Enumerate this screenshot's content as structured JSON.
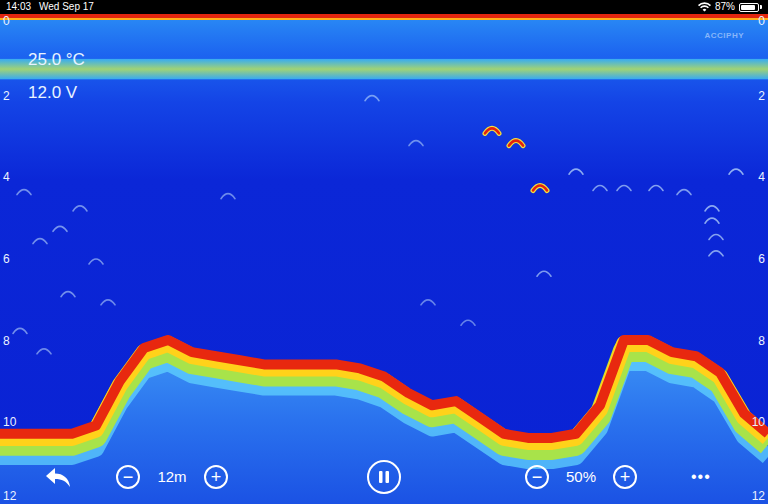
{
  "status_bar": {
    "time": "14:03",
    "date": "Wed Sep 17",
    "wifi": true,
    "battery": {
      "text": "87%",
      "level": 0.87
    }
  },
  "watermark": "ACCIPHY",
  "readings": [
    "25.0 °C",
    "12.0 V"
  ],
  "depth_scale": {
    "ticks": [
      "0",
      "2",
      "4",
      "6",
      "8",
      "10",
      "12"
    ],
    "max_depth": 12
  },
  "sonar": {
    "pings": 192,
    "surface_band": [
      1.1,
      1.6
    ],
    "bottom_depths": [
      9.9,
      9.9,
      9.9,
      9.9,
      9.7,
      8.6,
      7.8,
      7.6,
      7.9,
      8.0,
      8.1,
      8.2,
      8.2,
      8.2,
      8.2,
      8.3,
      8.5,
      8.9,
      9.2,
      9.1,
      9.5,
      9.9,
      10.0,
      10.0,
      9.9,
      9.2,
      7.6,
      7.6,
      7.9,
      8.0,
      8.4,
      9.4,
      9.9
    ],
    "fish": [
      {
        "ping": 123,
        "depth": 2.8,
        "strength": 0.95
      },
      {
        "ping": 129,
        "depth": 3.1,
        "strength": 0.9
      },
      {
        "ping": 135,
        "depth": 4.2,
        "strength": 0.9
      },
      {
        "ping": 144,
        "depth": 3.8,
        "strength": 0.5
      },
      {
        "ping": 150,
        "depth": 4.2,
        "strength": 0.4
      },
      {
        "ping": 156,
        "depth": 4.2,
        "strength": 0.4
      },
      {
        "ping": 164,
        "depth": 4.2,
        "strength": 0.45
      },
      {
        "ping": 171,
        "depth": 4.3,
        "strength": 0.4
      },
      {
        "ping": 184,
        "depth": 3.8,
        "strength": 0.55
      },
      {
        "ping": 178,
        "depth": 4.7,
        "strength": 0.5
      },
      {
        "ping": 178,
        "depth": 5.0,
        "strength": 0.5
      },
      {
        "ping": 179,
        "depth": 5.4,
        "strength": 0.45
      },
      {
        "ping": 179,
        "depth": 5.8,
        "strength": 0.45
      },
      {
        "ping": 136,
        "depth": 6.3,
        "strength": 0.4
      },
      {
        "ping": 93,
        "depth": 2.0,
        "strength": 0.3
      },
      {
        "ping": 104,
        "depth": 3.1,
        "strength": 0.25
      },
      {
        "ping": 57,
        "depth": 4.4,
        "strength": 0.25
      },
      {
        "ping": 5,
        "depth": 7.7,
        "strength": 0.3
      },
      {
        "ping": 6,
        "depth": 4.3,
        "strength": 0.3
      },
      {
        "ping": 10,
        "depth": 5.5,
        "strength": 0.3
      },
      {
        "ping": 11,
        "depth": 8.2,
        "strength": 0.25
      },
      {
        "ping": 15,
        "depth": 5.2,
        "strength": 0.35
      },
      {
        "ping": 17,
        "depth": 6.8,
        "strength": 0.3
      },
      {
        "ping": 20,
        "depth": 4.7,
        "strength": 0.3
      },
      {
        "ping": 24,
        "depth": 6.0,
        "strength": 0.3
      },
      {
        "ping": 27,
        "depth": 7.0,
        "strength": 0.25
      },
      {
        "ping": 107,
        "depth": 7.0,
        "strength": 0.2
      },
      {
        "ping": 117,
        "depth": 7.5,
        "strength": 0.2
      }
    ]
  },
  "toolbar": {
    "range": {
      "minus": "−",
      "value": "12m",
      "plus": "+"
    },
    "paused": false,
    "gain": {
      "minus": "−",
      "value": "50%",
      "plus": "+"
    },
    "more": "•••"
  }
}
